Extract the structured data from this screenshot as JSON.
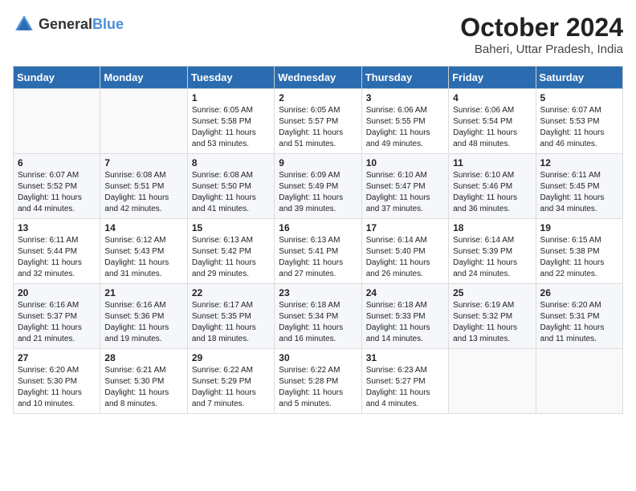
{
  "logo": {
    "general": "General",
    "blue": "Blue"
  },
  "header": {
    "month_year": "October 2024",
    "location": "Baheri, Uttar Pradesh, India"
  },
  "weekdays": [
    "Sunday",
    "Monday",
    "Tuesday",
    "Wednesday",
    "Thursday",
    "Friday",
    "Saturday"
  ],
  "weeks": [
    [
      {
        "day": "",
        "sunrise": "",
        "sunset": "",
        "daylight": ""
      },
      {
        "day": "",
        "sunrise": "",
        "sunset": "",
        "daylight": ""
      },
      {
        "day": "1",
        "sunrise": "Sunrise: 6:05 AM",
        "sunset": "Sunset: 5:58 PM",
        "daylight": "Daylight: 11 hours and 53 minutes."
      },
      {
        "day": "2",
        "sunrise": "Sunrise: 6:05 AM",
        "sunset": "Sunset: 5:57 PM",
        "daylight": "Daylight: 11 hours and 51 minutes."
      },
      {
        "day": "3",
        "sunrise": "Sunrise: 6:06 AM",
        "sunset": "Sunset: 5:55 PM",
        "daylight": "Daylight: 11 hours and 49 minutes."
      },
      {
        "day": "4",
        "sunrise": "Sunrise: 6:06 AM",
        "sunset": "Sunset: 5:54 PM",
        "daylight": "Daylight: 11 hours and 48 minutes."
      },
      {
        "day": "5",
        "sunrise": "Sunrise: 6:07 AM",
        "sunset": "Sunset: 5:53 PM",
        "daylight": "Daylight: 11 hours and 46 minutes."
      }
    ],
    [
      {
        "day": "6",
        "sunrise": "Sunrise: 6:07 AM",
        "sunset": "Sunset: 5:52 PM",
        "daylight": "Daylight: 11 hours and 44 minutes."
      },
      {
        "day": "7",
        "sunrise": "Sunrise: 6:08 AM",
        "sunset": "Sunset: 5:51 PM",
        "daylight": "Daylight: 11 hours and 42 minutes."
      },
      {
        "day": "8",
        "sunrise": "Sunrise: 6:08 AM",
        "sunset": "Sunset: 5:50 PM",
        "daylight": "Daylight: 11 hours and 41 minutes."
      },
      {
        "day": "9",
        "sunrise": "Sunrise: 6:09 AM",
        "sunset": "Sunset: 5:49 PM",
        "daylight": "Daylight: 11 hours and 39 minutes."
      },
      {
        "day": "10",
        "sunrise": "Sunrise: 6:10 AM",
        "sunset": "Sunset: 5:47 PM",
        "daylight": "Daylight: 11 hours and 37 minutes."
      },
      {
        "day": "11",
        "sunrise": "Sunrise: 6:10 AM",
        "sunset": "Sunset: 5:46 PM",
        "daylight": "Daylight: 11 hours and 36 minutes."
      },
      {
        "day": "12",
        "sunrise": "Sunrise: 6:11 AM",
        "sunset": "Sunset: 5:45 PM",
        "daylight": "Daylight: 11 hours and 34 minutes."
      }
    ],
    [
      {
        "day": "13",
        "sunrise": "Sunrise: 6:11 AM",
        "sunset": "Sunset: 5:44 PM",
        "daylight": "Daylight: 11 hours and 32 minutes."
      },
      {
        "day": "14",
        "sunrise": "Sunrise: 6:12 AM",
        "sunset": "Sunset: 5:43 PM",
        "daylight": "Daylight: 11 hours and 31 minutes."
      },
      {
        "day": "15",
        "sunrise": "Sunrise: 6:13 AM",
        "sunset": "Sunset: 5:42 PM",
        "daylight": "Daylight: 11 hours and 29 minutes."
      },
      {
        "day": "16",
        "sunrise": "Sunrise: 6:13 AM",
        "sunset": "Sunset: 5:41 PM",
        "daylight": "Daylight: 11 hours and 27 minutes."
      },
      {
        "day": "17",
        "sunrise": "Sunrise: 6:14 AM",
        "sunset": "Sunset: 5:40 PM",
        "daylight": "Daylight: 11 hours and 26 minutes."
      },
      {
        "day": "18",
        "sunrise": "Sunrise: 6:14 AM",
        "sunset": "Sunset: 5:39 PM",
        "daylight": "Daylight: 11 hours and 24 minutes."
      },
      {
        "day": "19",
        "sunrise": "Sunrise: 6:15 AM",
        "sunset": "Sunset: 5:38 PM",
        "daylight": "Daylight: 11 hours and 22 minutes."
      }
    ],
    [
      {
        "day": "20",
        "sunrise": "Sunrise: 6:16 AM",
        "sunset": "Sunset: 5:37 PM",
        "daylight": "Daylight: 11 hours and 21 minutes."
      },
      {
        "day": "21",
        "sunrise": "Sunrise: 6:16 AM",
        "sunset": "Sunset: 5:36 PM",
        "daylight": "Daylight: 11 hours and 19 minutes."
      },
      {
        "day": "22",
        "sunrise": "Sunrise: 6:17 AM",
        "sunset": "Sunset: 5:35 PM",
        "daylight": "Daylight: 11 hours and 18 minutes."
      },
      {
        "day": "23",
        "sunrise": "Sunrise: 6:18 AM",
        "sunset": "Sunset: 5:34 PM",
        "daylight": "Daylight: 11 hours and 16 minutes."
      },
      {
        "day": "24",
        "sunrise": "Sunrise: 6:18 AM",
        "sunset": "Sunset: 5:33 PM",
        "daylight": "Daylight: 11 hours and 14 minutes."
      },
      {
        "day": "25",
        "sunrise": "Sunrise: 6:19 AM",
        "sunset": "Sunset: 5:32 PM",
        "daylight": "Daylight: 11 hours and 13 minutes."
      },
      {
        "day": "26",
        "sunrise": "Sunrise: 6:20 AM",
        "sunset": "Sunset: 5:31 PM",
        "daylight": "Daylight: 11 hours and 11 minutes."
      }
    ],
    [
      {
        "day": "27",
        "sunrise": "Sunrise: 6:20 AM",
        "sunset": "Sunset: 5:30 PM",
        "daylight": "Daylight: 11 hours and 10 minutes."
      },
      {
        "day": "28",
        "sunrise": "Sunrise: 6:21 AM",
        "sunset": "Sunset: 5:30 PM",
        "daylight": "Daylight: 11 hours and 8 minutes."
      },
      {
        "day": "29",
        "sunrise": "Sunrise: 6:22 AM",
        "sunset": "Sunset: 5:29 PM",
        "daylight": "Daylight: 11 hours and 7 minutes."
      },
      {
        "day": "30",
        "sunrise": "Sunrise: 6:22 AM",
        "sunset": "Sunset: 5:28 PM",
        "daylight": "Daylight: 11 hours and 5 minutes."
      },
      {
        "day": "31",
        "sunrise": "Sunrise: 6:23 AM",
        "sunset": "Sunset: 5:27 PM",
        "daylight": "Daylight: 11 hours and 4 minutes."
      },
      {
        "day": "",
        "sunrise": "",
        "sunset": "",
        "daylight": ""
      },
      {
        "day": "",
        "sunrise": "",
        "sunset": "",
        "daylight": ""
      }
    ]
  ]
}
